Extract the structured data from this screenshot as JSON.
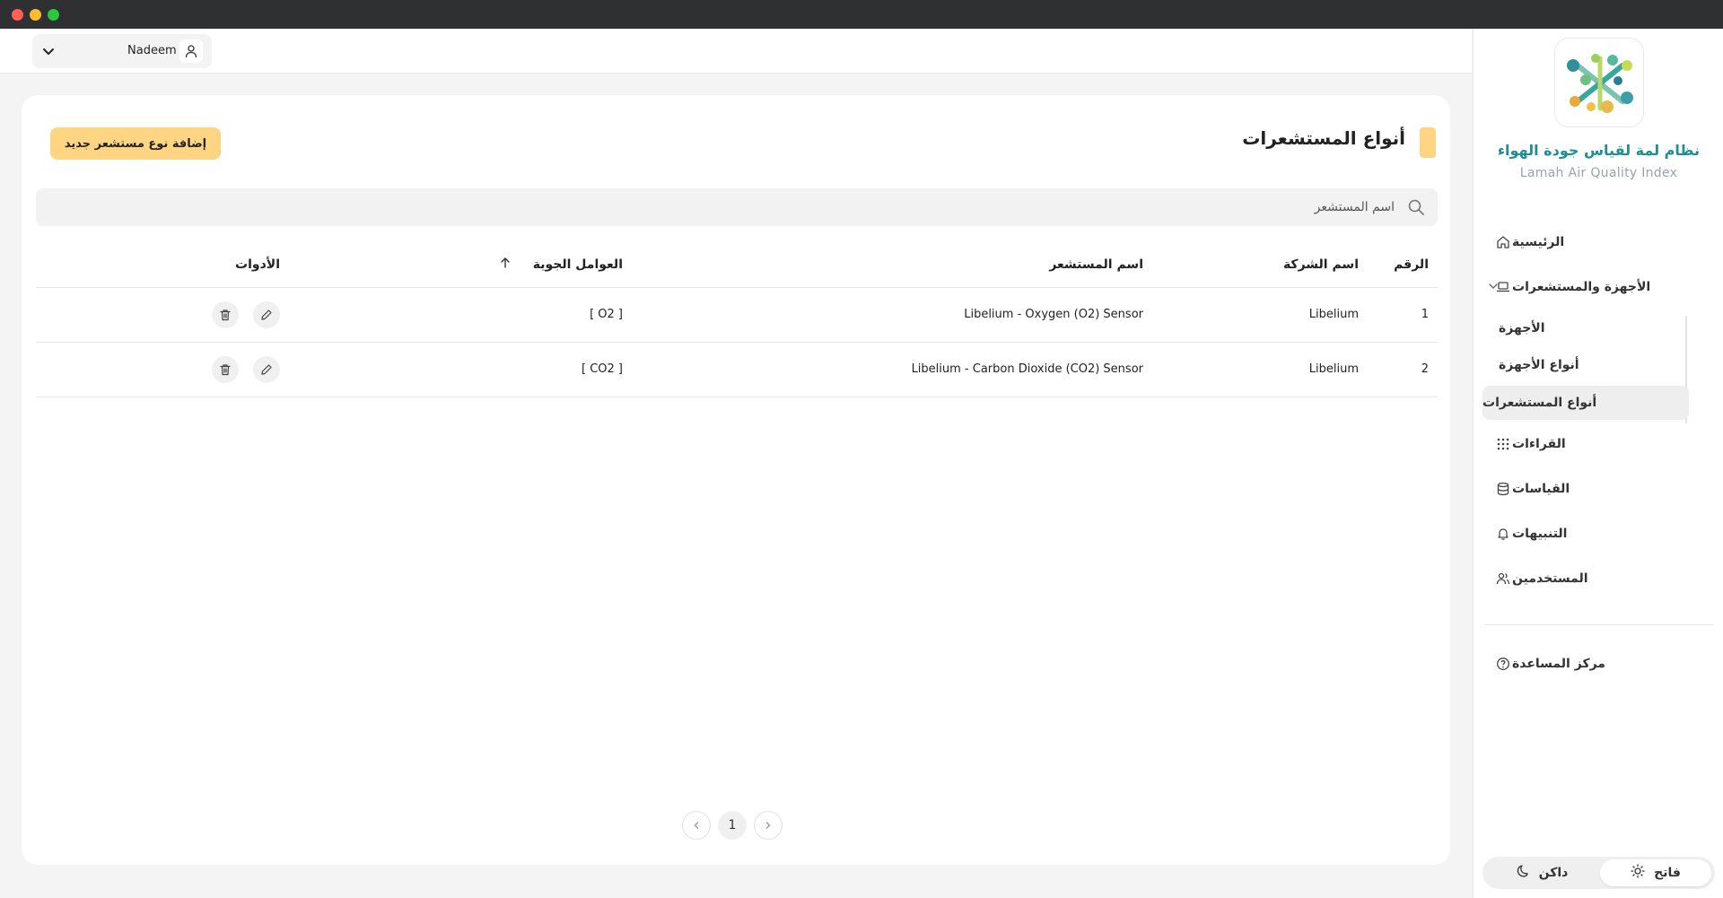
{
  "app": {
    "title": "نظام لمة لقياس جودة الهواء",
    "subtitle": "Lamah Air Quality Index"
  },
  "nav": {
    "home": "الرئيسية",
    "devices_sensors": "الأجهزة والمستشعرات",
    "devices": "الأجهزة",
    "device_types": "أنواع الأجهزة",
    "sensor_types": "أنواع المستشعرات",
    "readings": "القراءات",
    "measurements": "القياسات",
    "alerts": "التنبيهات",
    "users": "المستخدمين",
    "help_center": "مركز المساعدة"
  },
  "theme": {
    "light": "فاتح",
    "dark": "داكن"
  },
  "header": {
    "username": "Nadeem"
  },
  "page": {
    "title": "أنواع المستشعرات",
    "add_button": "إضافة نوع مستشعر جديد",
    "search_placeholder": "اسم المستشعر"
  },
  "table": {
    "columns": {
      "number": "الرقم",
      "company": "اسم الشركة",
      "sensor_name": "اسم المستشعر",
      "factors": "العوامل الجوية",
      "tools": "الأدوات"
    },
    "rows": [
      {
        "number": "1",
        "company": "Libelium",
        "sensor_name": "Libelium - Oxygen (O2) Sensor",
        "factors": "[ O2 ]"
      },
      {
        "number": "2",
        "company": "Libelium",
        "sensor_name": "Libelium - Carbon Dioxide (CO2) Sensor",
        "factors": "[ CO2 ]"
      }
    ]
  },
  "pagination": {
    "current": "1"
  },
  "colors": {
    "accent": "#ffd482",
    "brand_teal": "#1d8f95",
    "titlebar": "#2f3032"
  },
  "icons": {
    "home": "home-icon",
    "devices": "laptop-icon",
    "readings": "grid-icon",
    "measurements": "database-icon",
    "alerts": "bell-icon",
    "users": "users-icon",
    "help": "help-circle-icon"
  }
}
